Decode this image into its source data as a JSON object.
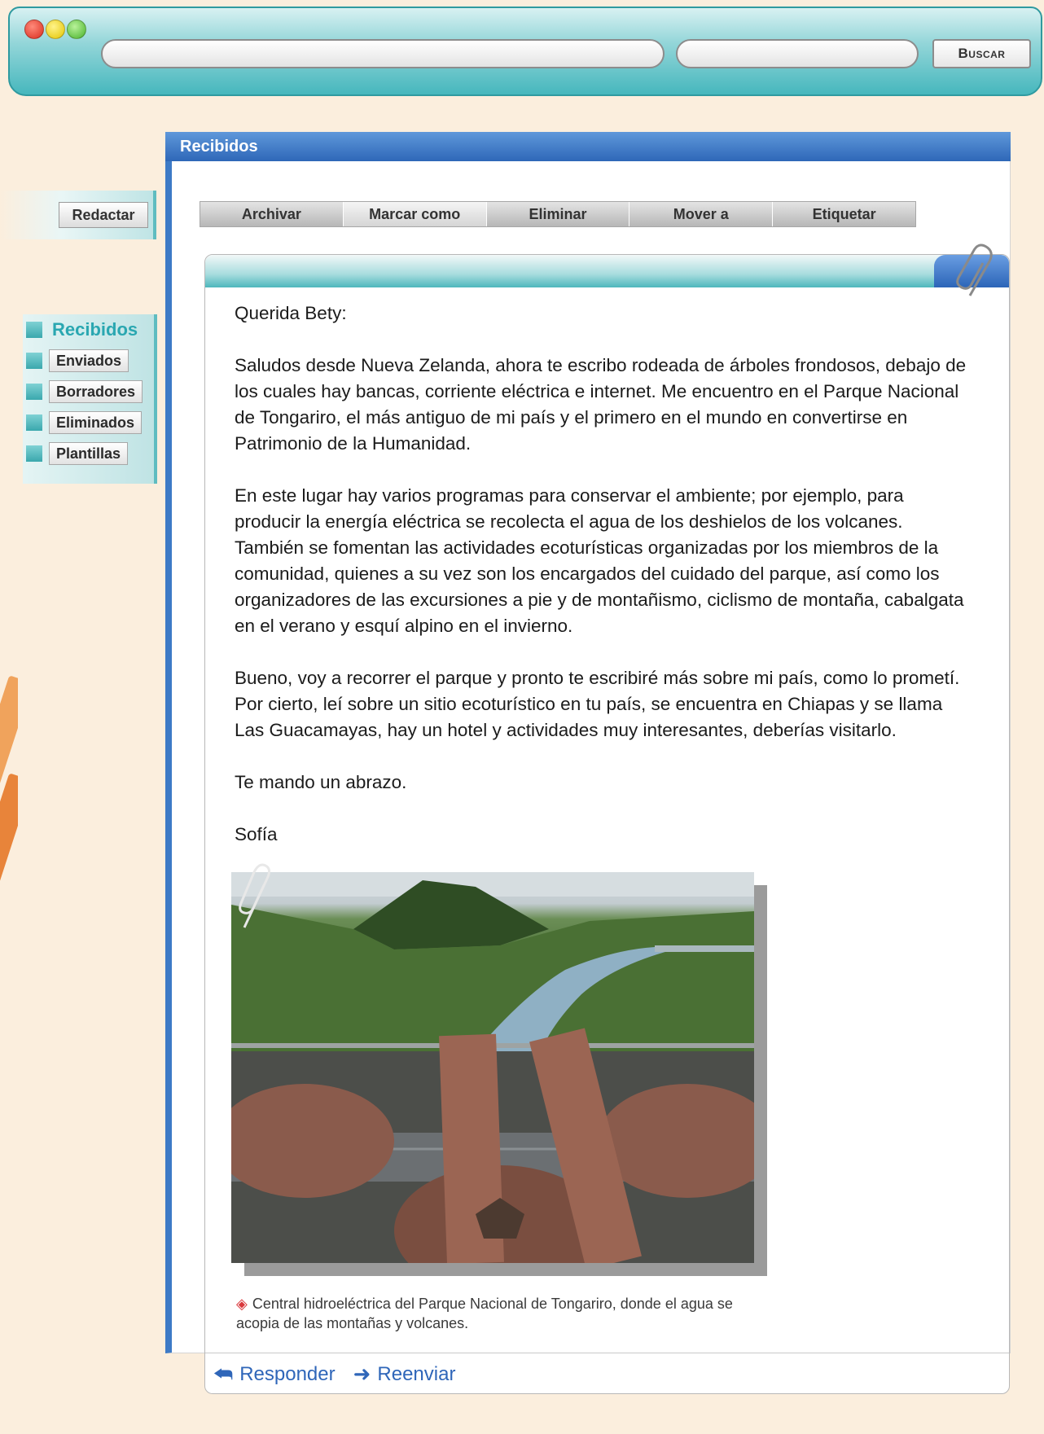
{
  "browser": {
    "search_button": "Buscar"
  },
  "window": {
    "title": "Recibidos"
  },
  "sidebar": {
    "compose_label": "Redactar",
    "folders": [
      {
        "label": "Recibidos",
        "active": true
      },
      {
        "label": "Enviados",
        "active": false
      },
      {
        "label": "Borradores",
        "active": false
      },
      {
        "label": "Eliminados",
        "active": false
      },
      {
        "label": "Plantillas",
        "active": false
      }
    ]
  },
  "toolbar": {
    "items": [
      "Archivar",
      "Marcar como",
      "Eliminar",
      "Mover a",
      "Etiquetar"
    ]
  },
  "message": {
    "greeting": "Querida Bety:",
    "paragraphs": [
      "Saludos desde Nueva Zelanda, ahora te escribo rodeada de árboles frondosos, debajo de los cuales hay bancas, corriente eléctrica e internet. Me encuentro en el Parque Nacional de Tongariro, el más antiguo de mi país y el primero en el mundo en convertirse en Patrimonio de la Humanidad.",
      "En este lugar hay varios programas para conservar el ambiente; por ejemplo, para producir la energía eléctrica se recolecta el agua de los deshielos de los volcanes. También se fomentan las actividades ecoturísticas organizadas por los miembros de la comunidad, quienes a su vez son los encargados del cuidado del parque, así como los organizadores de las excursiones a pie y de montañismo, ciclismo de montaña, cabalgata en el verano y esquí alpino en el invierno.",
      "Bueno, voy a recorrer el parque y pronto te escribiré más sobre mi país, como lo prometí. Por cierto, leí sobre un sitio ecoturístico en tu país, se encuentra en Chiapas y se llama Las Guacamayas, hay un hotel y actividades muy interesantes, deberías visitarlo."
    ],
    "closing": "Te mando un abrazo.",
    "signature": "Sofía",
    "photo_caption": "Central hidroeléctrica del Parque Nacional de Tongariro, donde el agua se acopia de las montañas y volcanes.",
    "reply_label": "Responder",
    "forward_label": "Reenviar"
  },
  "colors": {
    "accent_teal": "#2aa7b1",
    "header_blue": "#2e67b8",
    "link_blue": "#2f66b9",
    "caption_bullet": "#d9383c"
  },
  "icons": {
    "reply": "reply-arrow-icon",
    "forward": "forward-arrow-icon",
    "paperclip": "paperclip-icon"
  }
}
